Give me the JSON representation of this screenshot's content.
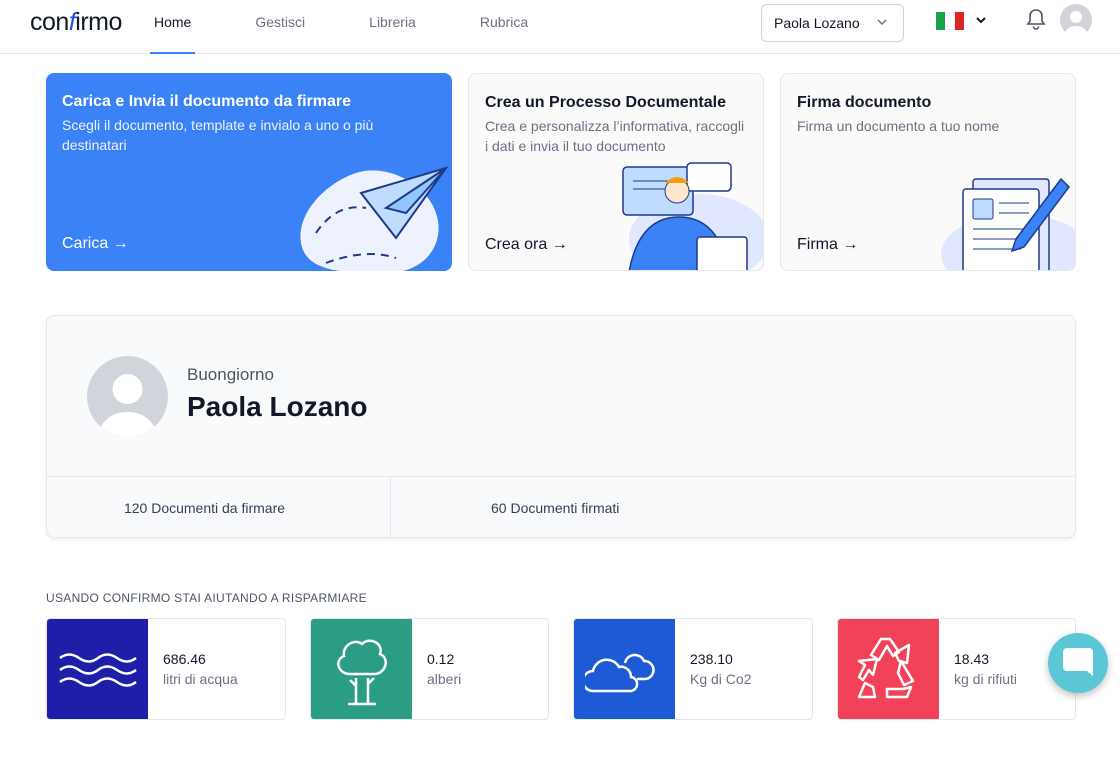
{
  "header": {
    "logo": {
      "prefix": "con",
      "accent": "f",
      "suffix": "irmo"
    },
    "nav": [
      {
        "label": "Home",
        "active": true
      },
      {
        "label": "Gestisci"
      },
      {
        "label": "Libreria"
      },
      {
        "label": "Rubrica"
      }
    ],
    "user_select": "Paola Lozano",
    "language_flag_colors": [
      "#16a34a",
      "#ffffff",
      "#dc2626"
    ],
    "icons": [
      "chevron-down-icon",
      "bell-icon",
      "user-avatar-icon"
    ]
  },
  "cards": [
    {
      "title": "Carica e Invia il documento da firmare",
      "description": "Scegli il documento, template e invialo a uno o più destinatari",
      "cta": "Carica →",
      "color": "#3b82f6"
    },
    {
      "title": "Crea un Processo Documentale",
      "description": "Crea e personalizza l’informativa, raccogli i dati e invia il tuo documento",
      "cta": "Crea ora →"
    },
    {
      "title": "Firma documento",
      "description": "Firma un documento a tuo nome",
      "cta": "Firma →"
    }
  ],
  "profile": {
    "greeting": "Buongiorno",
    "name": "Paola Lozano",
    "stats": [
      {
        "value": "120",
        "label": "Documenti da firmare"
      },
      {
        "value": "60",
        "label": "Documenti firmati"
      }
    ]
  },
  "savings": {
    "title": "USANDO CONFIRMO STAI AIUTANDO A RISPARMIARE",
    "items": [
      {
        "value": "686.46",
        "unit": "litri di acqua",
        "icon": "water-waves-icon",
        "color": "#1e1ea8"
      },
      {
        "value": "0.12",
        "unit": "alberi",
        "icon": "tree-icon",
        "color": "#2a9d84"
      },
      {
        "value": "238.10",
        "unit": "Kg di Co2",
        "icon": "cloud-icon",
        "color": "#1e5ad6"
      },
      {
        "value": "18.43",
        "unit": "kg di rifiuti",
        "icon": "recycle-icon",
        "color": "#f2425a"
      }
    ]
  },
  "chat_button": {
    "icon": "chat-bubble-icon",
    "color": "#5bc7d5"
  }
}
